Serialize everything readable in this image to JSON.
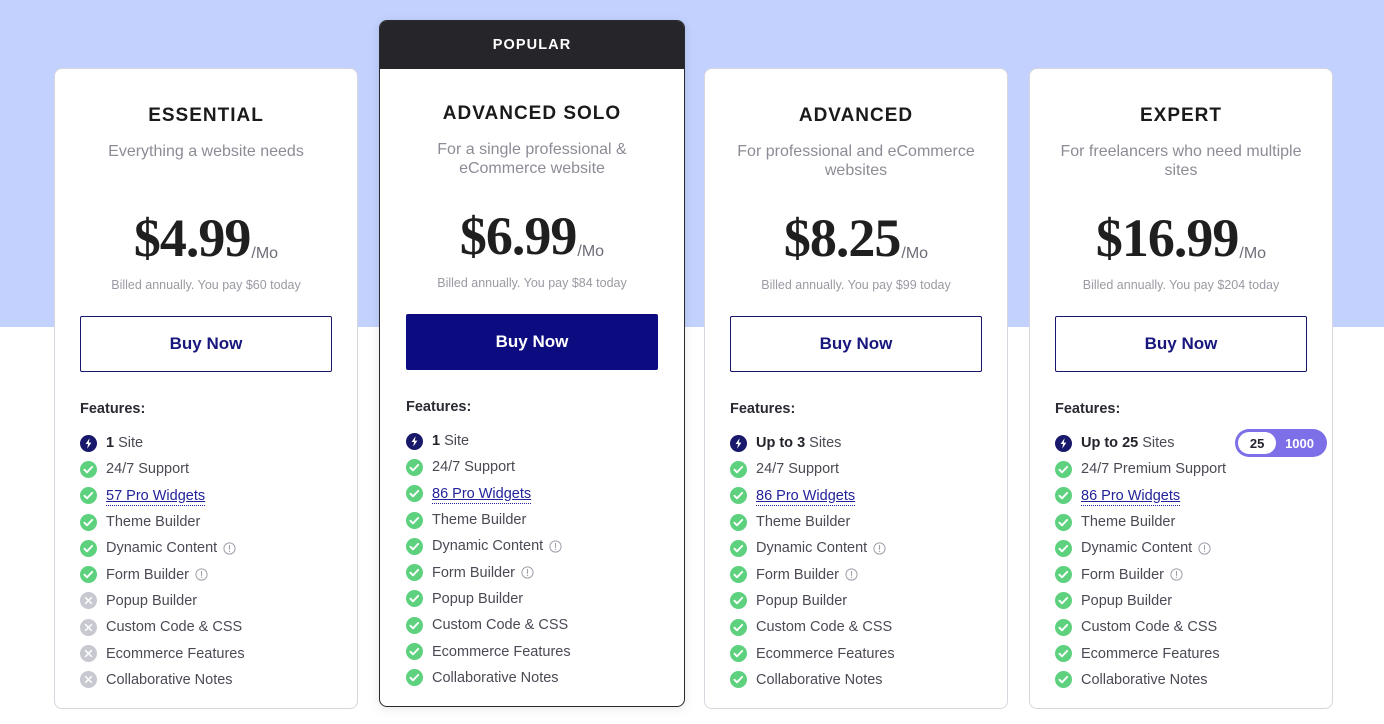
{
  "colors": {
    "background_band": "#c2d1fd",
    "accent_navy": "#0c0c80",
    "popular_banner": "#26262a",
    "check_green": "#5ed17e",
    "cross_gray": "#c8c8d0",
    "badge_purple": "#7c6fe8",
    "link_blue": "#22229a"
  },
  "plans": [
    {
      "name": "ESSENTIAL",
      "description": "Everything a website needs",
      "price": "$4.99",
      "period": "/Mo",
      "billed_note": "Billed annually. You pay $60 today",
      "cta_label": "Buy Now",
      "featured": false,
      "features_title": "Features:",
      "features": [
        {
          "icon": "bolt-icon",
          "bold": "1",
          "text": " Site"
        },
        {
          "icon": "check-icon",
          "text": "24/7 Support"
        },
        {
          "icon": "check-icon",
          "link": "57 Pro Widgets"
        },
        {
          "icon": "check-icon",
          "text": "Theme Builder"
        },
        {
          "icon": "check-icon",
          "text": "Dynamic Content",
          "info": true
        },
        {
          "icon": "check-icon",
          "text": "Form Builder",
          "info": true
        },
        {
          "icon": "cross-icon",
          "text": "Popup Builder"
        },
        {
          "icon": "cross-icon",
          "text": "Custom Code & CSS"
        },
        {
          "icon": "cross-icon",
          "text": "Ecommerce Features"
        },
        {
          "icon": "cross-icon",
          "text": "Collaborative Notes"
        }
      ]
    },
    {
      "name": "ADVANCED SOLO",
      "badge_label": "POPULAR",
      "description": "For a single professional & eCommerce website",
      "price": "$6.99",
      "period": "/Mo",
      "billed_note": "Billed annually. You pay $84 today",
      "cta_label": "Buy Now",
      "featured": true,
      "features_title": "Features:",
      "features": [
        {
          "icon": "bolt-icon",
          "bold": "1",
          "text": " Site"
        },
        {
          "icon": "check-icon",
          "text": "24/7 Support"
        },
        {
          "icon": "check-icon",
          "link": "86 Pro Widgets"
        },
        {
          "icon": "check-icon",
          "text": "Theme Builder"
        },
        {
          "icon": "check-icon",
          "text": "Dynamic Content",
          "info": true
        },
        {
          "icon": "check-icon",
          "text": "Form Builder",
          "info": true
        },
        {
          "icon": "check-icon",
          "text": "Popup Builder"
        },
        {
          "icon": "check-icon",
          "text": "Custom Code & CSS"
        },
        {
          "icon": "check-icon",
          "text": "Ecommerce Features"
        },
        {
          "icon": "check-icon",
          "text": "Collaborative Notes"
        }
      ]
    },
    {
      "name": "ADVANCED",
      "description": "For professional and eCommerce websites",
      "price": "$8.25",
      "period": "/Mo",
      "billed_note": "Billed annually. You pay $99 today",
      "cta_label": "Buy Now",
      "featured": false,
      "features_title": "Features:",
      "features": [
        {
          "icon": "bolt-icon",
          "bold": "Up to 3",
          "text": " Sites"
        },
        {
          "icon": "check-icon",
          "text": "24/7 Support"
        },
        {
          "icon": "check-icon",
          "link": "86 Pro Widgets"
        },
        {
          "icon": "check-icon",
          "text": "Theme Builder"
        },
        {
          "icon": "check-icon",
          "text": "Dynamic Content",
          "info": true
        },
        {
          "icon": "check-icon",
          "text": "Form Builder",
          "info": true
        },
        {
          "icon": "check-icon",
          "text": "Popup Builder"
        },
        {
          "icon": "check-icon",
          "text": "Custom Code & CSS"
        },
        {
          "icon": "check-icon",
          "text": "Ecommerce Features"
        },
        {
          "icon": "check-icon",
          "text": "Collaborative Notes"
        }
      ]
    },
    {
      "name": "EXPERT",
      "description": "For freelancers who need multiple sites",
      "price": "$16.99",
      "period": "/Mo",
      "billed_note": "Billed annually. You pay $204 today",
      "cta_label": "Buy Now",
      "featured": false,
      "features_title": "Features:",
      "sites_badge": {
        "selected": "25",
        "alternative": "1000"
      },
      "features": [
        {
          "icon": "bolt-icon",
          "bold": "Up to 25",
          "text": " Sites",
          "badge": true
        },
        {
          "icon": "check-icon",
          "text": "24/7 Premium Support"
        },
        {
          "icon": "check-icon",
          "link": "86 Pro Widgets"
        },
        {
          "icon": "check-icon",
          "text": "Theme Builder"
        },
        {
          "icon": "check-icon",
          "text": "Dynamic Content",
          "info": true
        },
        {
          "icon": "check-icon",
          "text": "Form Builder",
          "info": true
        },
        {
          "icon": "check-icon",
          "text": "Popup Builder"
        },
        {
          "icon": "check-icon",
          "text": "Custom Code & CSS"
        },
        {
          "icon": "check-icon",
          "text": "Ecommerce Features"
        },
        {
          "icon": "check-icon",
          "text": "Collaborative Notes"
        }
      ]
    }
  ]
}
